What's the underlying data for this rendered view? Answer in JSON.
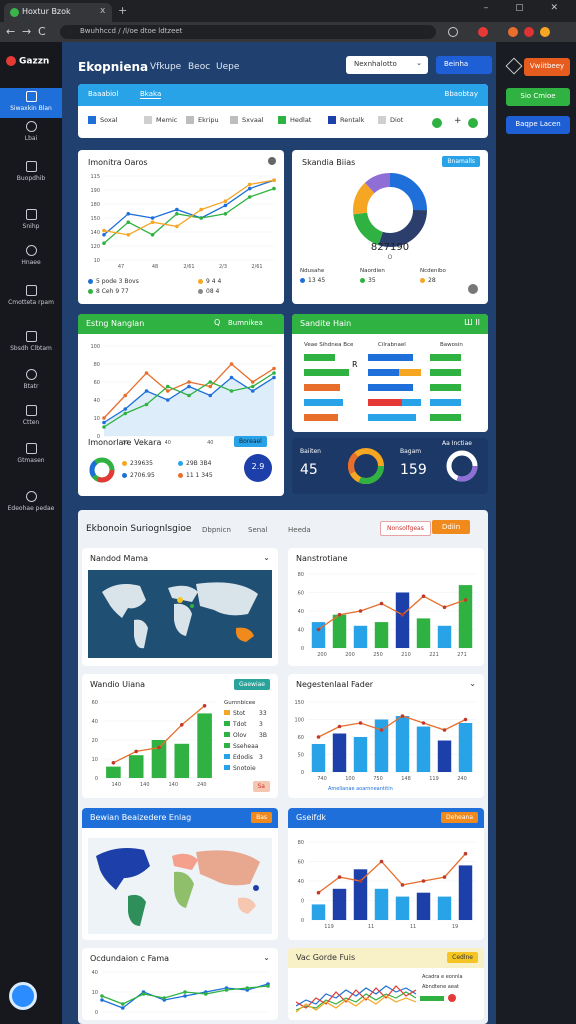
{
  "browser": {
    "tab_title": "Hoxtur Bzok",
    "tab_close": "x",
    "new_tab": "+",
    "window_controls": "– ▢ ✕",
    "url": "Bwuhhccd / /l/oe dtoe ldtzeet",
    "nav": [
      "←",
      "→",
      "C"
    ]
  },
  "sidebar": {
    "brand": "Gazzn",
    "items": [
      {
        "label": "Siwaxkin Blan",
        "active": true
      },
      {
        "label": "Lbai"
      },
      {
        "label": "Buopdhib"
      },
      {
        "label": "Snihp"
      },
      {
        "label": "Hnaee"
      },
      {
        "label": "Cmotteta rpam"
      },
      {
        "label": "Sbsdh Clbtam"
      },
      {
        "label": "Btatr"
      },
      {
        "label": "Ctten"
      },
      {
        "label": "Gtmasen"
      },
      {
        "label": "Edeohae pedae"
      }
    ]
  },
  "header": {
    "title": "Ekopniena",
    "nav": [
      "Vfkupe",
      "Beoc",
      "Uepe"
    ],
    "select_label": "Nexnhalotto",
    "select_chevron": "⌄",
    "primary_label": "Beinha"
  },
  "right_panel": {
    "buttons": [
      "Vwiitbeey",
      "Sio Cmioe",
      "Baqpe Lacen"
    ]
  },
  "tabs": {
    "header_left": "Baaabiol",
    "header_mid": "Bkaka",
    "header_right": "Bbaobtay",
    "items": [
      "Soxal",
      "Memic",
      "Ekripu",
      "Sxvaal",
      "Hedlat",
      "Rentalk",
      "Diot"
    ],
    "plus": "+"
  },
  "card1": {
    "title": "Imonitra Oaros",
    "legend": [
      {
        "dot": "#1e6fd9",
        "label": "5 pode",
        "value": "3 Bovs"
      },
      {
        "dot": "#2fb241",
        "label": "8 Ceh",
        "value": "9 77"
      },
      {
        "dot": "#f5a623",
        "label": "9 4",
        "value": "4"
      },
      {
        "dot": "#888888",
        "label": "08",
        "value": "4"
      }
    ]
  },
  "card2": {
    "title": "Skandia Biias",
    "chip": "Bnamalls",
    "center_value": "827190",
    "center_sub": "O",
    "legend": [
      {
        "label": "Ndusahe",
        "value": "13 45"
      },
      {
        "label": "Naordien",
        "value": "35"
      },
      {
        "label": "Ncdenibo",
        "value": "28"
      }
    ]
  },
  "card3": {
    "header": "Estng Nanglan",
    "header_icon": "Q",
    "header_btn": "Bumnikea",
    "sub_title": "Imonorlare Vekara",
    "sub_chip": "Boreael",
    "legend": [
      {
        "label": "239635",
        "value": "29B 3B4"
      },
      {
        "label": "2706.95",
        "value": "11 1 345"
      }
    ],
    "badge": "2.9"
  },
  "card4": {
    "header": "Sandite Hain",
    "header_icons": "Ш ⅠⅠ",
    "col1": "Veae Sihdnea Bce",
    "col2": "Cilrabnael",
    "col3": "Bawosin",
    "marker": "R"
  },
  "stats": {
    "a_label": "Baiiten",
    "a_value": "45",
    "b_label": "Bagam",
    "b_value": "159",
    "c_label": "Aa Inctiae"
  },
  "section2": {
    "title": "Ekbonoin Suriognlsgioe",
    "tabs": [
      "Dbpnicn",
      "Senal",
      "Heeda"
    ],
    "btn_outline": "Nonsolfgeas",
    "btn_orange": "Ddiin"
  },
  "panel_map1": {
    "title": "Nandod Mama"
  },
  "panel_bar1": {
    "title": "Nanstrotiane"
  },
  "panel_combo1": {
    "title": "Wandio Uiana",
    "chip": "Gaewiae",
    "legend_title": "Gumnbicee",
    "legend": [
      {
        "label": "Stot",
        "value": "33"
      },
      {
        "label": "Tdot",
        "value": "3"
      },
      {
        "label": "Olov",
        "value": "3B"
      },
      {
        "label": "Sseheaa",
        "value": ""
      },
      {
        "label": "Edodis",
        "value": "3"
      },
      {
        "label": "Snotoie",
        "value": ""
      }
    ],
    "footer": "Sa"
  },
  "panel_bar2": {
    "title": "Negestenlaal Fader",
    "footer": "Amellanae aoarnneantitin"
  },
  "panel_map2": {
    "title": "Bewian Beaizedere Enlag",
    "chip": "Bas"
  },
  "panel_bar3": {
    "title": "Gseifdk",
    "chip": "Deheana"
  },
  "panel_line3": {
    "title": "Ocdundaion c Fama"
  },
  "panel_heat": {
    "title": "Vac Gorde Fuis",
    "chip": "Cedlne",
    "sub": "Acadra e eonnla",
    "sub2": "Abndtene aeat"
  },
  "chart_data": [
    {
      "type": "line",
      "id": "card1",
      "categories": [
        "47",
        "48",
        "2/61",
        "2/3",
        "2/61"
      ],
      "yticks": [
        "115",
        "190",
        "180",
        "150",
        "140",
        "120",
        "10"
      ],
      "series": [
        {
          "color": "#1e6fd9",
          "values": [
            0.3,
            0.55,
            0.5,
            0.6,
            0.5,
            0.65,
            0.85,
            0.95
          ]
        },
        {
          "color": "#2fb241",
          "values": [
            0.2,
            0.45,
            0.3,
            0.55,
            0.5,
            0.55,
            0.75,
            0.85
          ]
        },
        {
          "color": "#f5a623",
          "values": [
            0.35,
            0.3,
            0.45,
            0.4,
            0.6,
            0.7,
            0.9,
            0.95
          ]
        }
      ]
    },
    {
      "type": "pie",
      "id": "card2",
      "values": [
        25,
        30,
        18,
        15,
        12
      ],
      "colors": [
        "#1e6fd9",
        "#2c3e6b",
        "#2fb241",
        "#f5a623",
        "#8f6ed5"
      ]
    },
    {
      "type": "line",
      "id": "card3",
      "categories": [
        "30",
        "40",
        "40",
        "24"
      ],
      "yticks": [
        "100",
        "80",
        "60",
        "40",
        "10",
        "0"
      ],
      "series": [
        {
          "color": "#e86e2c",
          "values": [
            0.2,
            0.45,
            0.7,
            0.5,
            0.6,
            0.55,
            0.8,
            0.6,
            0.75
          ]
        },
        {
          "color": "#1e6fd9",
          "values": [
            0.15,
            0.3,
            0.5,
            0.4,
            0.55,
            0.45,
            0.65,
            0.5,
            0.65
          ]
        },
        {
          "color": "#2fb241",
          "values": [
            0.1,
            0.25,
            0.35,
            0.55,
            0.45,
            0.6,
            0.5,
            0.55,
            0.7
          ]
        }
      ]
    },
    {
      "type": "bar",
      "id": "panel_bar1",
      "categories": [
        "200",
        "200",
        "250",
        "210",
        "221",
        "271"
      ],
      "yticks": [
        "80",
        "60",
        "40",
        "40",
        "0"
      ],
      "values": [
        0.35,
        0.45,
        0.3,
        0.35,
        0.75,
        0.4,
        0.3,
        0.85
      ],
      "colors": [
        "#29a3e8",
        "#2fb241",
        "#29a3e8",
        "#2fb241",
        "#1c3faa",
        "#2fb241",
        "#29a3e8",
        "#2fb241"
      ],
      "line": [
        0.25,
        0.45,
        0.5,
        0.6,
        0.45,
        0.7,
        0.55,
        0.65
      ]
    },
    {
      "type": "bar",
      "id": "panel_combo1",
      "categories": [
        "140",
        "140",
        "140",
        "240"
      ],
      "yticks": [
        "60",
        "40",
        "20",
        "10",
        "0"
      ],
      "values": [
        0.15,
        0.3,
        0.5,
        0.45,
        0.85
      ],
      "colors": [
        "#2fb241",
        "#2fb241",
        "#2fb241",
        "#2fb241",
        "#2fb241"
      ],
      "line": [
        0.2,
        0.35,
        0.4,
        0.7,
        0.95
      ]
    },
    {
      "type": "bar",
      "id": "panel_bar2",
      "categories": [
        "740",
        "100",
        "750",
        "148",
        "119",
        "240"
      ],
      "yticks": [
        "150",
        "100",
        "60",
        "50",
        "0"
      ],
      "values": [
        0.4,
        0.55,
        0.5,
        0.75,
        0.8,
        0.65,
        0.45,
        0.7
      ],
      "colors": [
        "#29a3e8",
        "#1c3faa",
        "#29a3e8",
        "#29a3e8",
        "#29a3e8",
        "#29a3e8",
        "#1c3faa",
        "#29a3e8"
      ],
      "line": [
        0.5,
        0.65,
        0.7,
        0.6,
        0.8,
        0.7,
        0.6,
        0.75
      ]
    },
    {
      "type": "bar",
      "id": "panel_bar3",
      "categories": [
        "119",
        "11",
        "11",
        "19"
      ],
      "yticks": [
        "80",
        "60",
        "40",
        "0",
        "0"
      ],
      "values": [
        0.2,
        0.4,
        0.65,
        0.4,
        0.3,
        0.35,
        0.3,
        0.7
      ],
      "colors": [
        "#29a3e8",
        "#1c3faa",
        "#1c3faa",
        "#29a3e8",
        "#29a3e8",
        "#1c3faa",
        "#29a3e8",
        "#1c3faa"
      ],
      "line": [
        0.35,
        0.55,
        0.5,
        0.75,
        0.45,
        0.5,
        0.55,
        0.85
      ]
    },
    {
      "type": "line",
      "id": "panel_line3",
      "yticks": [
        "40",
        "10",
        "0"
      ],
      "series": [
        {
          "color": "#1e6fd9",
          "values": [
            0.3,
            0.1,
            0.5,
            0.3,
            0.4,
            0.5,
            0.6,
            0.55,
            0.7
          ]
        },
        {
          "color": "#2fb241",
          "values": [
            0.4,
            0.2,
            0.45,
            0.35,
            0.5,
            0.45,
            0.55,
            0.6,
            0.65
          ]
        }
      ]
    }
  ]
}
